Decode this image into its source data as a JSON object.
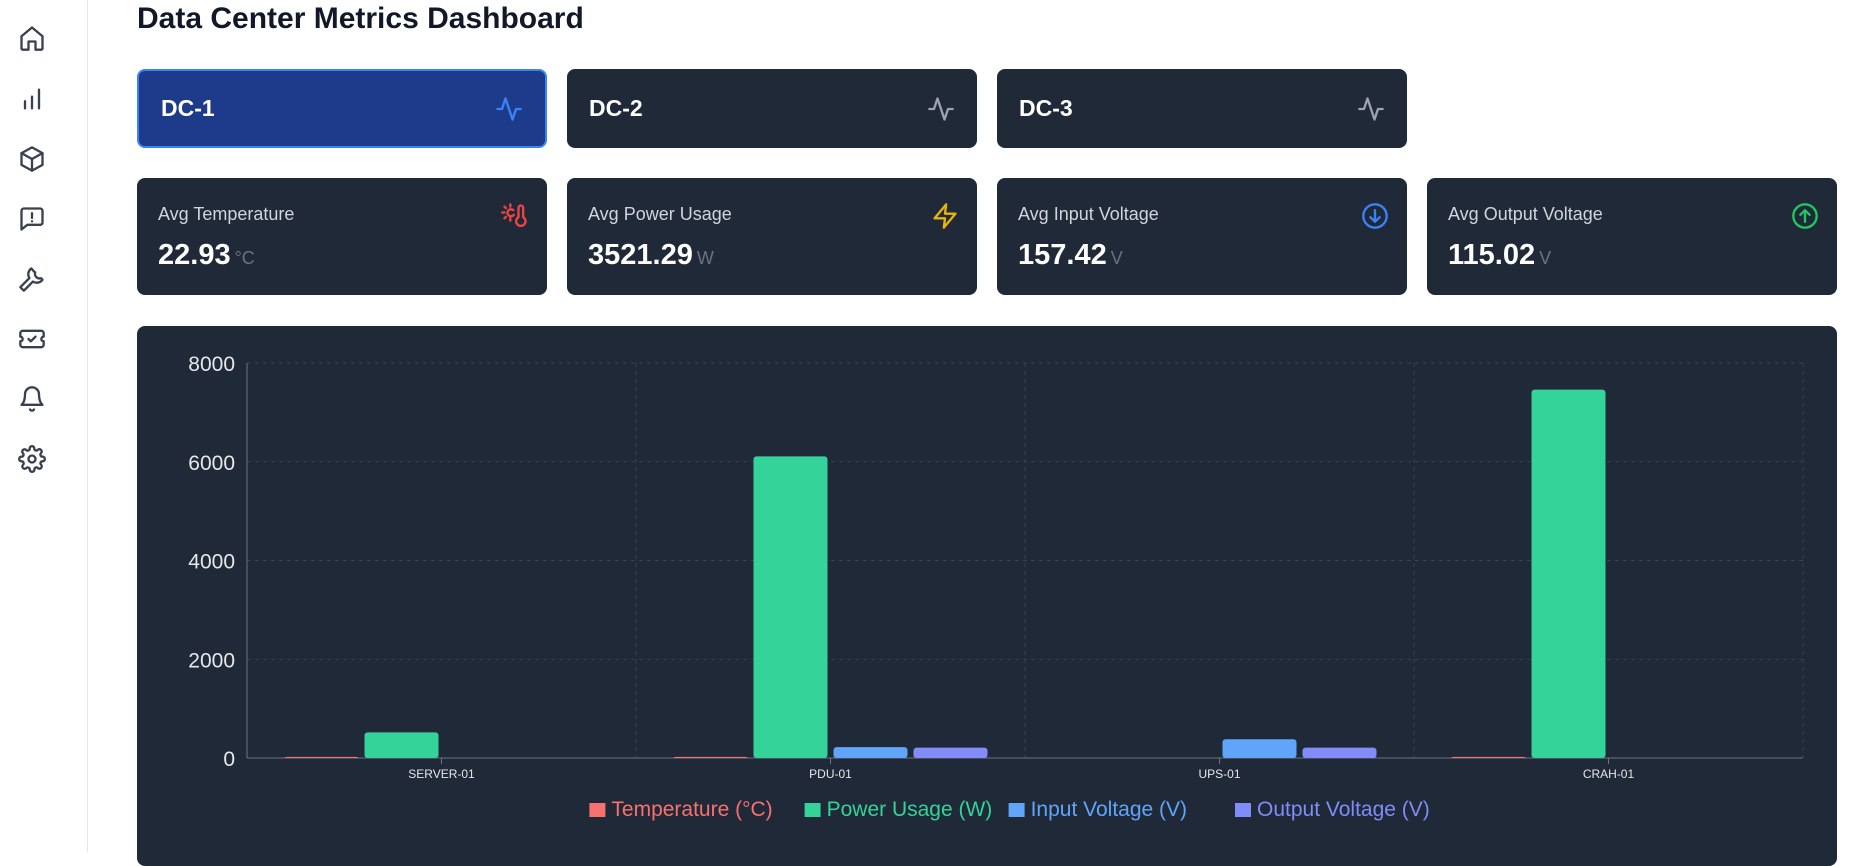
{
  "page_title": "Data Center Metrics Dashboard",
  "sidebar": {
    "items": [
      {
        "icon": "home-icon"
      },
      {
        "icon": "bar-chart-icon"
      },
      {
        "icon": "cube-icon"
      },
      {
        "icon": "message-alert-icon"
      },
      {
        "icon": "wrench-icon"
      },
      {
        "icon": "ticket-icon"
      },
      {
        "icon": "bell-icon"
      },
      {
        "icon": "gear-icon"
      }
    ]
  },
  "data_centers": [
    {
      "label": "DC-1",
      "active": true
    },
    {
      "label": "DC-2",
      "active": false
    },
    {
      "label": "DC-3",
      "active": false
    }
  ],
  "stats": [
    {
      "label": "Avg Temperature",
      "value": "22.93",
      "unit": "°C",
      "icon": "thermometer-sun-icon",
      "color": "#ef4444"
    },
    {
      "label": "Avg Power Usage",
      "value": "3521.29",
      "unit": "W",
      "icon": "lightning-icon",
      "color": "#eab308"
    },
    {
      "label": "Avg Input Voltage",
      "value": "157.42",
      "unit": "V",
      "icon": "arrow-down-circle-icon",
      "color": "#3b82f6"
    },
    {
      "label": "Avg Output Voltage",
      "value": "115.02",
      "unit": "V",
      "icon": "arrow-up-circle-icon",
      "color": "#22c55e"
    }
  ],
  "chart_data": {
    "type": "bar",
    "categories": [
      "SERVER-01",
      "PDU-01",
      "UPS-01",
      "CRAH-01"
    ],
    "series": [
      {
        "name": "Temperature (°C)",
        "color": "#f87171",
        "values": [
          22,
          24,
          0,
          23
        ]
      },
      {
        "name": "Power Usage (W)",
        "color": "#34d399",
        "values": [
          520,
          6110,
          0,
          7460
        ]
      },
      {
        "name": "Input Voltage (V)",
        "color": "#60a5fa",
        "values": [
          0,
          220,
          380,
          0
        ]
      },
      {
        "name": "Output Voltage (V)",
        "color": "#818cf8",
        "values": [
          0,
          210,
          210,
          0
        ]
      }
    ],
    "yticks": [
      0,
      2000,
      4000,
      6000,
      8000
    ],
    "ylim": [
      0,
      8000
    ],
    "grid": true,
    "legend": "bottom"
  }
}
